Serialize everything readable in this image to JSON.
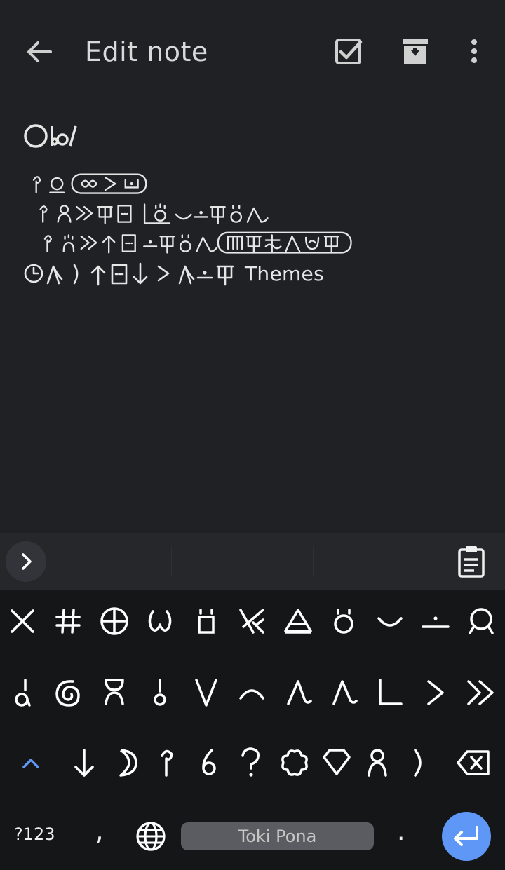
{
  "app_bar": {
    "title": "Edit note",
    "back_icon": "arrow-left-icon",
    "actions": [
      "checkbox-icon",
      "archive-icon",
      "more-vert-icon"
    ]
  },
  "note": {
    "title_glyphs": "lon",
    "body_text_suffix": "Themes"
  },
  "suggestion_bar": {
    "expand_icon": "chevron-right-icon",
    "clipboard_icon": "clipboard-icon"
  },
  "keyboard": {
    "symbols_label": "?123",
    "comma_label": ",",
    "space_label": "Toki Pona",
    "period_label": ".",
    "accent_color": "#5e97f6"
  }
}
